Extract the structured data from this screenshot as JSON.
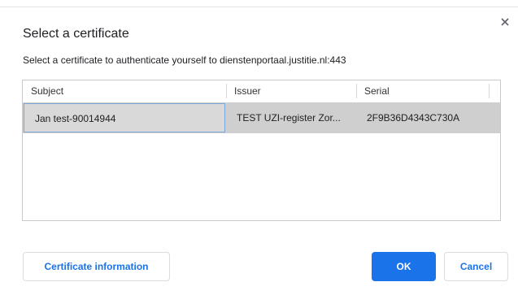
{
  "dialog": {
    "title": "Select a certificate",
    "subtitle": "Select a certificate to authenticate yourself to dienstenportaal.justitie.nl:443",
    "close_icon": "close-icon"
  },
  "table": {
    "headers": [
      "Subject",
      "Issuer",
      "Serial"
    ],
    "rows": [
      {
        "subject": "Jan test-90014944",
        "issuer": "TEST UZI-register Zor...",
        "serial": "2F9B36D4343C730A",
        "selected": true
      }
    ]
  },
  "buttons": {
    "certificate_information": "Certificate information",
    "ok": "OK",
    "cancel": "Cancel"
  },
  "colors": {
    "accent": "#1a73e8",
    "selected_row": "#cfcfcf",
    "focus_border": "#7aa7d8"
  }
}
